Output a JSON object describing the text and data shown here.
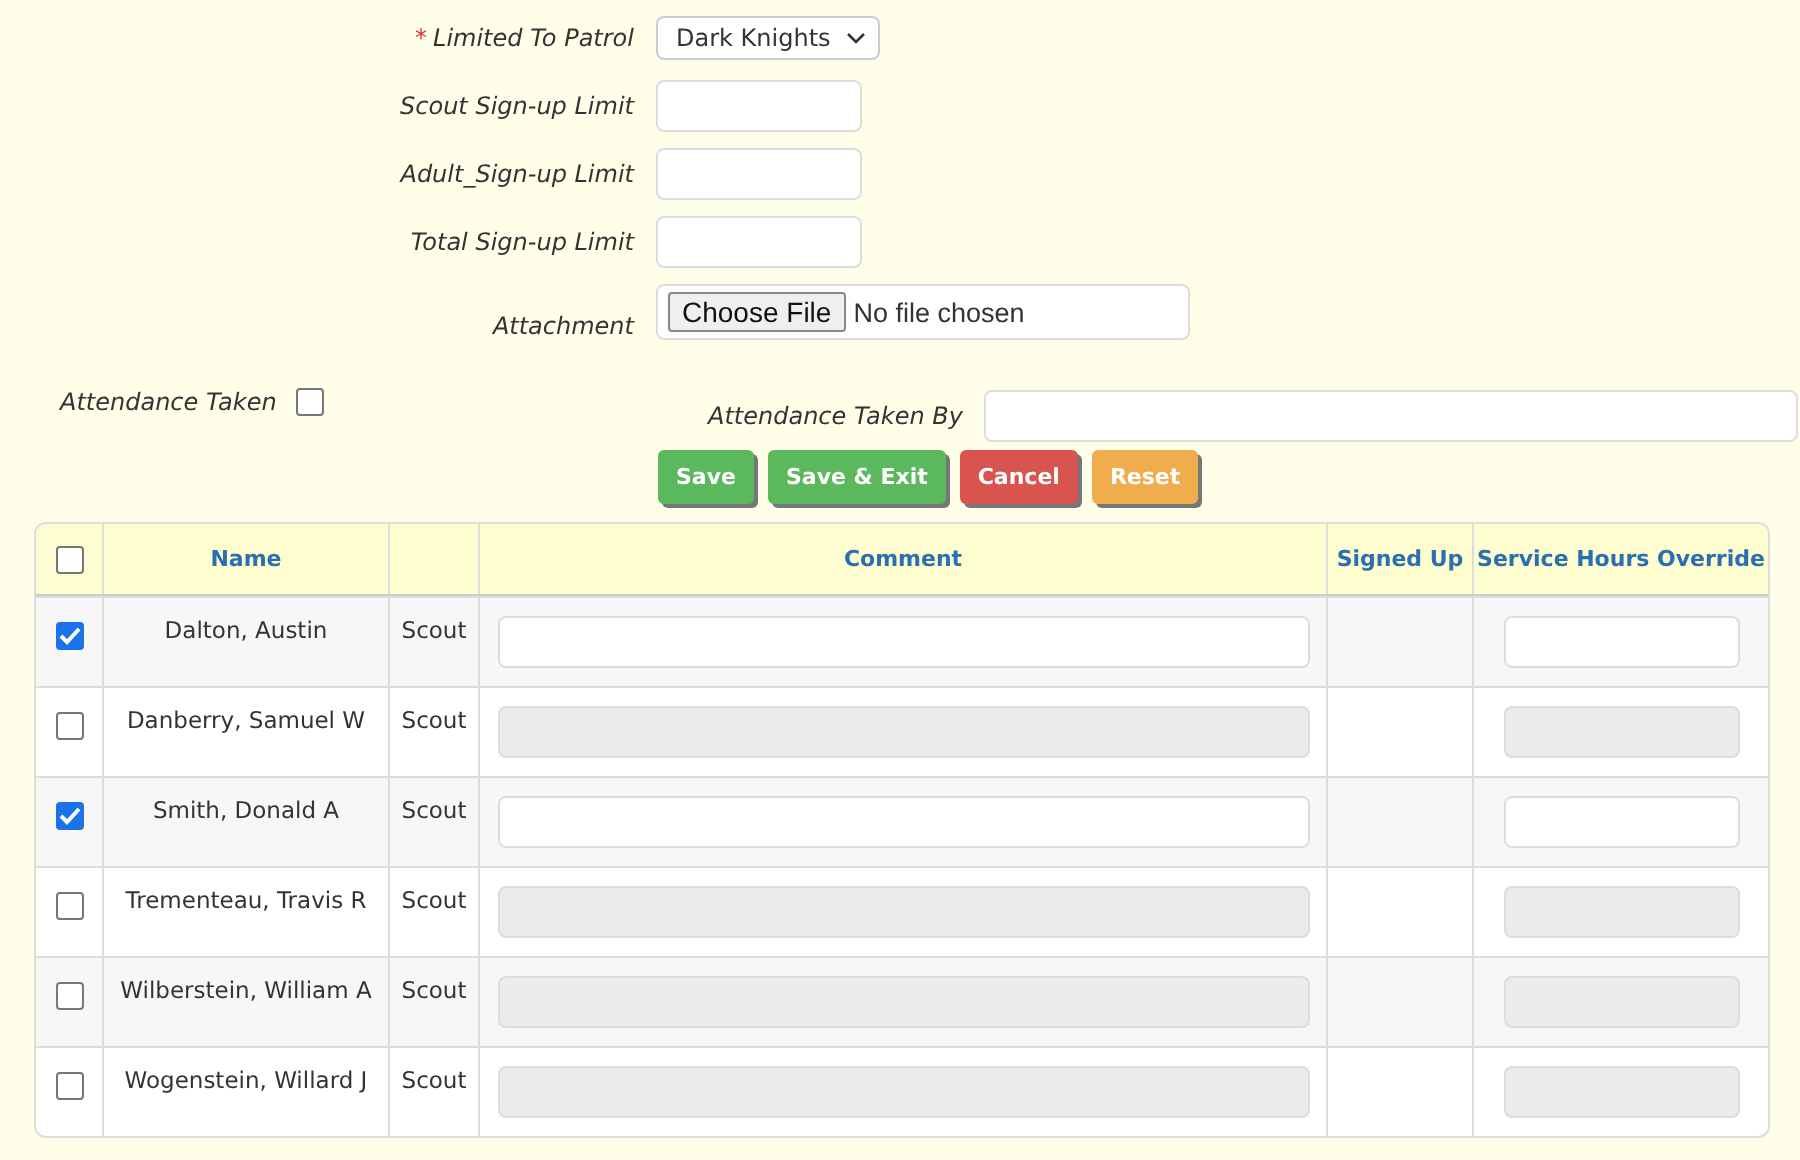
{
  "form": {
    "fields": [
      {
        "kind": "select",
        "marker": "*",
        "label": "Limited To Patrol",
        "value": "Dark Knights"
      },
      {
        "kind": "text",
        "label": "Scout Sign-up Limit"
      },
      {
        "kind": "text",
        "label": "Adult_Sign-up Limit"
      },
      {
        "kind": "text",
        "label": "Total Sign-up Limit"
      },
      {
        "kind": "file",
        "label": "Attachment",
        "button": "Choose File",
        "status": "No file chosen"
      }
    ]
  },
  "attendance": {
    "label": "Attendance Taken",
    "checked": false,
    "by_label": "Attendance Taken By"
  },
  "buttons": [
    {
      "label": "Save",
      "kind": "success"
    },
    {
      "label": "Save & Exit",
      "kind": "success"
    },
    {
      "label": "Cancel",
      "kind": "danger"
    },
    {
      "label": "Reset",
      "kind": "warning"
    }
  ],
  "table": {
    "select_all": {
      "checked": false
    },
    "columns": [
      "Name",
      "",
      "Comment",
      "Signed Up",
      "Service Hours Override"
    ],
    "rows": [
      {
        "checked": true,
        "name": "Dalton, Austin",
        "type": "Scout"
      },
      {
        "checked": false,
        "name": "Danberry, Samuel W",
        "type": "Scout"
      },
      {
        "checked": true,
        "name": "Smith, Donald A",
        "type": "Scout"
      },
      {
        "checked": false,
        "name": "Trementeau, Travis R",
        "type": "Scout"
      },
      {
        "checked": false,
        "name": "Wilberstein, William A",
        "type": "Scout"
      },
      {
        "checked": false,
        "name": "Wogenstein, Willard J",
        "type": "Scout"
      }
    ]
  }
}
